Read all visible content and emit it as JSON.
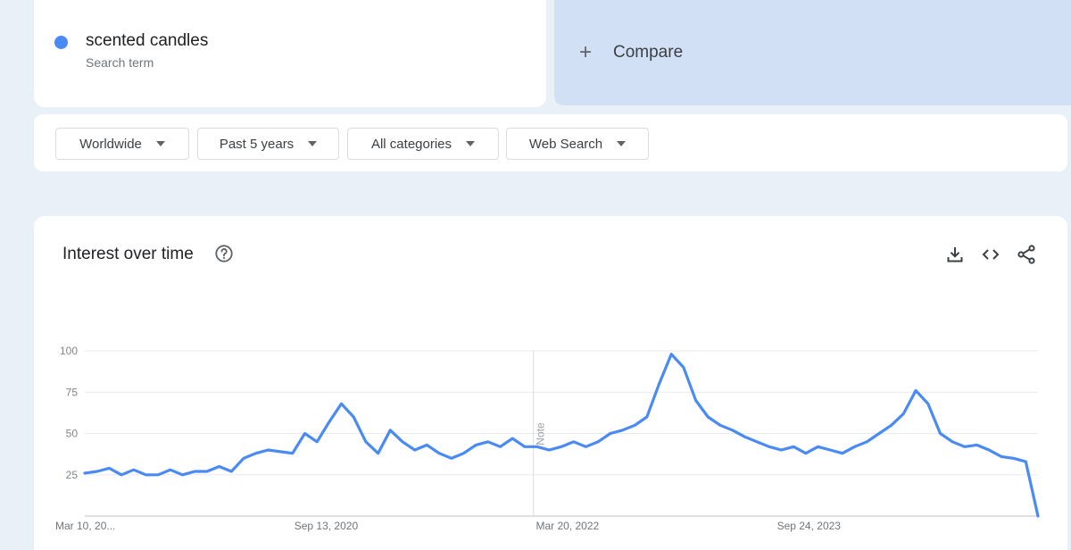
{
  "search_term": {
    "name": "scented candles",
    "subtitle": "Search term",
    "color": "#4a8af4"
  },
  "compare": {
    "label": "Compare",
    "icon": "plus-icon"
  },
  "filters": [
    {
      "label": "Worldwide"
    },
    {
      "label": "Past 5 years"
    },
    {
      "label": "All categories"
    },
    {
      "label": "Web Search"
    }
  ],
  "chart_panel": {
    "title": "Interest over time",
    "help_icon": "help-circle-icon",
    "tools": [
      "download-icon",
      "embed-code-icon",
      "share-icon"
    ]
  },
  "chart_data": {
    "type": "line",
    "title": "Interest over time",
    "y_ticks": [
      "100",
      "75",
      "50",
      "25"
    ],
    "ylim": [
      0,
      100
    ],
    "grid": true,
    "x_tick_labels": [
      "Mar 10, 20...",
      "Sep 13, 2020",
      "Mar 20, 2022",
      "Sep 24, 2023"
    ],
    "note_label": "Note",
    "series": [
      {
        "color": "#4a8af4",
        "points": [
          [
            "2019-03-10",
            26
          ],
          [
            "2019-04-07",
            27
          ],
          [
            "2019-05-05",
            29
          ],
          [
            "2019-06-02",
            25
          ],
          [
            "2019-06-30",
            28
          ],
          [
            "2019-07-28",
            25
          ],
          [
            "2019-08-25",
            25
          ],
          [
            "2019-09-22",
            28
          ],
          [
            "2019-10-20",
            25
          ],
          [
            "2019-11-17",
            27
          ],
          [
            "2019-12-15",
            27
          ],
          [
            "2020-01-12",
            30
          ],
          [
            "2020-02-09",
            27
          ],
          [
            "2020-03-08",
            35
          ],
          [
            "2020-04-05",
            38
          ],
          [
            "2020-05-03",
            40
          ],
          [
            "2020-06-28",
            38
          ],
          [
            "2020-07-26",
            50
          ],
          [
            "2020-08-23",
            45
          ],
          [
            "2020-09-20",
            57
          ],
          [
            "2020-10-18",
            68
          ],
          [
            "2020-11-15",
            60
          ],
          [
            "2020-12-13",
            45
          ],
          [
            "2021-01-10",
            38
          ],
          [
            "2021-02-07",
            52
          ],
          [
            "2021-03-07",
            45
          ],
          [
            "2021-04-04",
            40
          ],
          [
            "2021-05-02",
            43
          ],
          [
            "2021-05-30",
            38
          ],
          [
            "2021-06-27",
            35
          ],
          [
            "2021-07-25",
            38
          ],
          [
            "2021-08-22",
            43
          ],
          [
            "2021-09-19",
            45
          ],
          [
            "2021-10-17",
            42
          ],
          [
            "2021-11-14",
            47
          ],
          [
            "2021-12-12",
            42
          ],
          [
            "2022-01-09",
            42
          ],
          [
            "2022-02-06",
            40
          ],
          [
            "2022-03-06",
            42
          ],
          [
            "2022-04-03",
            45
          ],
          [
            "2022-05-01",
            42
          ],
          [
            "2022-05-29",
            45
          ],
          [
            "2022-06-26",
            50
          ],
          [
            "2022-07-24",
            52
          ],
          [
            "2022-08-21",
            55
          ],
          [
            "2022-09-18",
            60
          ],
          [
            "2022-10-16",
            80
          ],
          [
            "2022-11-13",
            98
          ],
          [
            "2022-12-11",
            90
          ],
          [
            "2023-01-08",
            70
          ],
          [
            "2023-02-05",
            60
          ],
          [
            "2023-03-05",
            55
          ],
          [
            "2023-04-02",
            52
          ],
          [
            "2023-04-30",
            48
          ],
          [
            "2023-05-28",
            45
          ],
          [
            "2023-06-25",
            42
          ],
          [
            "2023-07-23",
            40
          ],
          [
            "2023-08-20",
            42
          ],
          [
            "2023-09-17",
            38
          ],
          [
            "2023-10-15",
            42
          ],
          [
            "2023-11-12",
            40
          ],
          [
            "2023-12-10",
            38
          ],
          [
            "2024-01-07",
            42
          ],
          [
            "2024-02-04",
            45
          ],
          [
            "2024-03-03",
            50
          ],
          [
            "2024-03-31",
            55
          ],
          [
            "2024-04-28",
            62
          ],
          [
            "2024-05-26",
            76
          ],
          [
            "2024-06-23",
            68
          ],
          [
            "2024-07-21",
            50
          ],
          [
            "2024-08-18",
            45
          ],
          [
            "2024-09-15",
            42
          ],
          [
            "2024-10-13",
            43
          ],
          [
            "2024-11-10",
            40
          ],
          [
            "2024-12-08",
            36
          ],
          [
            "2025-01-05",
            35
          ],
          [
            "2025-02-02",
            33
          ],
          [
            "2025-03-02",
            0
          ]
        ]
      }
    ]
  }
}
